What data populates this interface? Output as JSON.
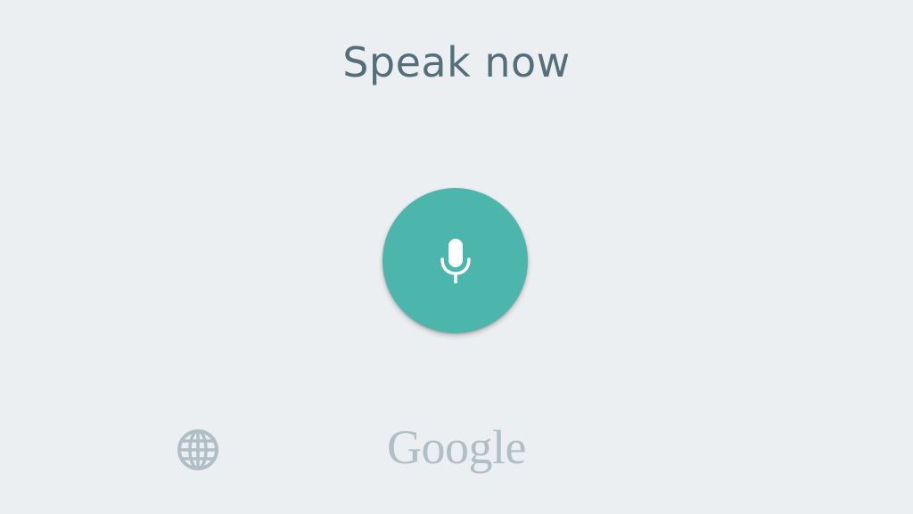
{
  "prompt": {
    "title": "Speak now"
  },
  "mic_button": {
    "icon": "microphone-icon",
    "color": "#4db6ac"
  },
  "language_button": {
    "icon": "globe-icon"
  },
  "brand": {
    "text": "Google"
  },
  "colors": {
    "background": "#eceff1",
    "title": "#546e7a",
    "muted": "#b0bec5",
    "accent": "#4db6ac"
  }
}
